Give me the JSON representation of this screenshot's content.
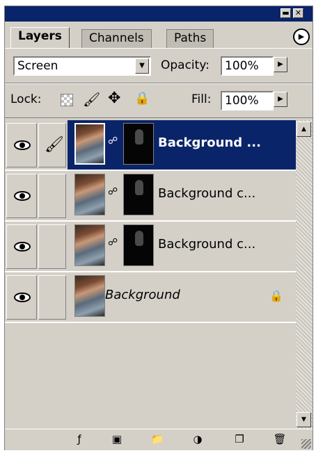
{
  "tabs": [
    "Layers",
    "Channels",
    "Paths"
  ],
  "blend_mode": "Screen",
  "opacity": {
    "label": "Opacity:",
    "value": "100%"
  },
  "lock": {
    "label": "Lock:"
  },
  "fill": {
    "label": "Fill:",
    "value": "100%"
  },
  "layers": [
    {
      "name": "Background ...",
      "selected": true,
      "visible": true,
      "has_mask": true
    },
    {
      "name": "Background c...",
      "selected": false,
      "visible": true,
      "has_mask": true
    },
    {
      "name": "Background c...",
      "selected": false,
      "visible": true,
      "has_mask": true
    },
    {
      "name": "Background",
      "selected": false,
      "visible": true,
      "has_mask": false,
      "locked": true
    }
  ],
  "icons": {
    "window": [
      "minimize-icon",
      "close-icon"
    ],
    "lock_options": [
      "lock-transparency-icon",
      "lock-paint-icon",
      "lock-move-icon",
      "lock-all-icon"
    ],
    "bottom": [
      "layer-style-icon",
      "layer-mask-icon",
      "layer-group-icon",
      "adjustment-layer-icon",
      "new-layer-icon",
      "trash-icon"
    ]
  },
  "colors": {
    "title_bar": "#0a246a",
    "selected_row": "#0a246a",
    "panel": "#d4d0c8"
  }
}
